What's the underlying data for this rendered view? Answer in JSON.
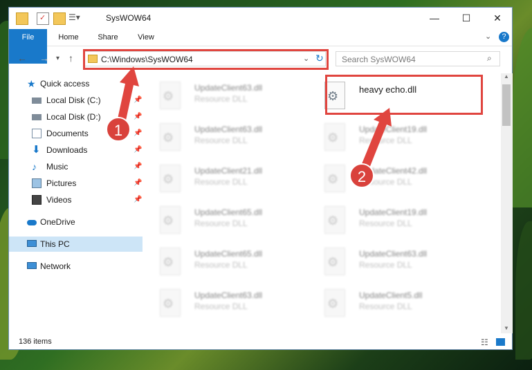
{
  "window": {
    "title": "SysWOW64",
    "tabs": [
      "File",
      "Home",
      "Share",
      "View"
    ]
  },
  "address": {
    "path": "C:\\Windows\\SysWOW64",
    "search_placeholder": "Search SysWOW64"
  },
  "nav": {
    "quick_access": "Quick access",
    "items": [
      {
        "label": "Local Disk (C:)",
        "icon": "drive-icon"
      },
      {
        "label": "Local Disk (D:)",
        "icon": "drive-icon"
      },
      {
        "label": "Documents",
        "icon": "documents-icon"
      },
      {
        "label": "Downloads",
        "icon": "downloads-icon"
      },
      {
        "label": "Music",
        "icon": "music-icon"
      },
      {
        "label": "Pictures",
        "icon": "pictures-icon"
      },
      {
        "label": "Videos",
        "icon": "videos-icon"
      }
    ],
    "onedrive": "OneDrive",
    "this_pc": "This PC",
    "network": "Network"
  },
  "files": {
    "highlighted": {
      "name": "heavy echo.dll",
      "type": ""
    },
    "left_column": [
      {
        "name": "UpdateClient63.dll",
        "type": "Resource DLL"
      },
      {
        "name": "UpdateClient63.dll",
        "type": "Resource DLL"
      },
      {
        "name": "UpdateClient21.dll",
        "type": "Resource DLL"
      },
      {
        "name": "UpdateClient65.dll",
        "type": "Resource DLL"
      },
      {
        "name": "UpdateClient65.dll",
        "type": "Resource DLL"
      },
      {
        "name": "UpdateClient63.dll",
        "type": "Resource DLL"
      }
    ],
    "right_column": [
      {
        "name": "UpdateClient19.dll",
        "type": "Resource DLL"
      },
      {
        "name": "UpdateClient42.dll",
        "type": "Resource DLL"
      },
      {
        "name": "UpdateClient19.dll",
        "type": "Resource DLL"
      },
      {
        "name": "UpdateClient63.dll",
        "type": "Resource DLL"
      },
      {
        "name": "UpdateClient5.dll",
        "type": "Resource DLL"
      }
    ]
  },
  "status": {
    "count": "136 items"
  },
  "annotations": {
    "step1": "1",
    "step2": "2"
  },
  "colors": {
    "accent": "#1979ca",
    "highlight": "#e0453f"
  }
}
